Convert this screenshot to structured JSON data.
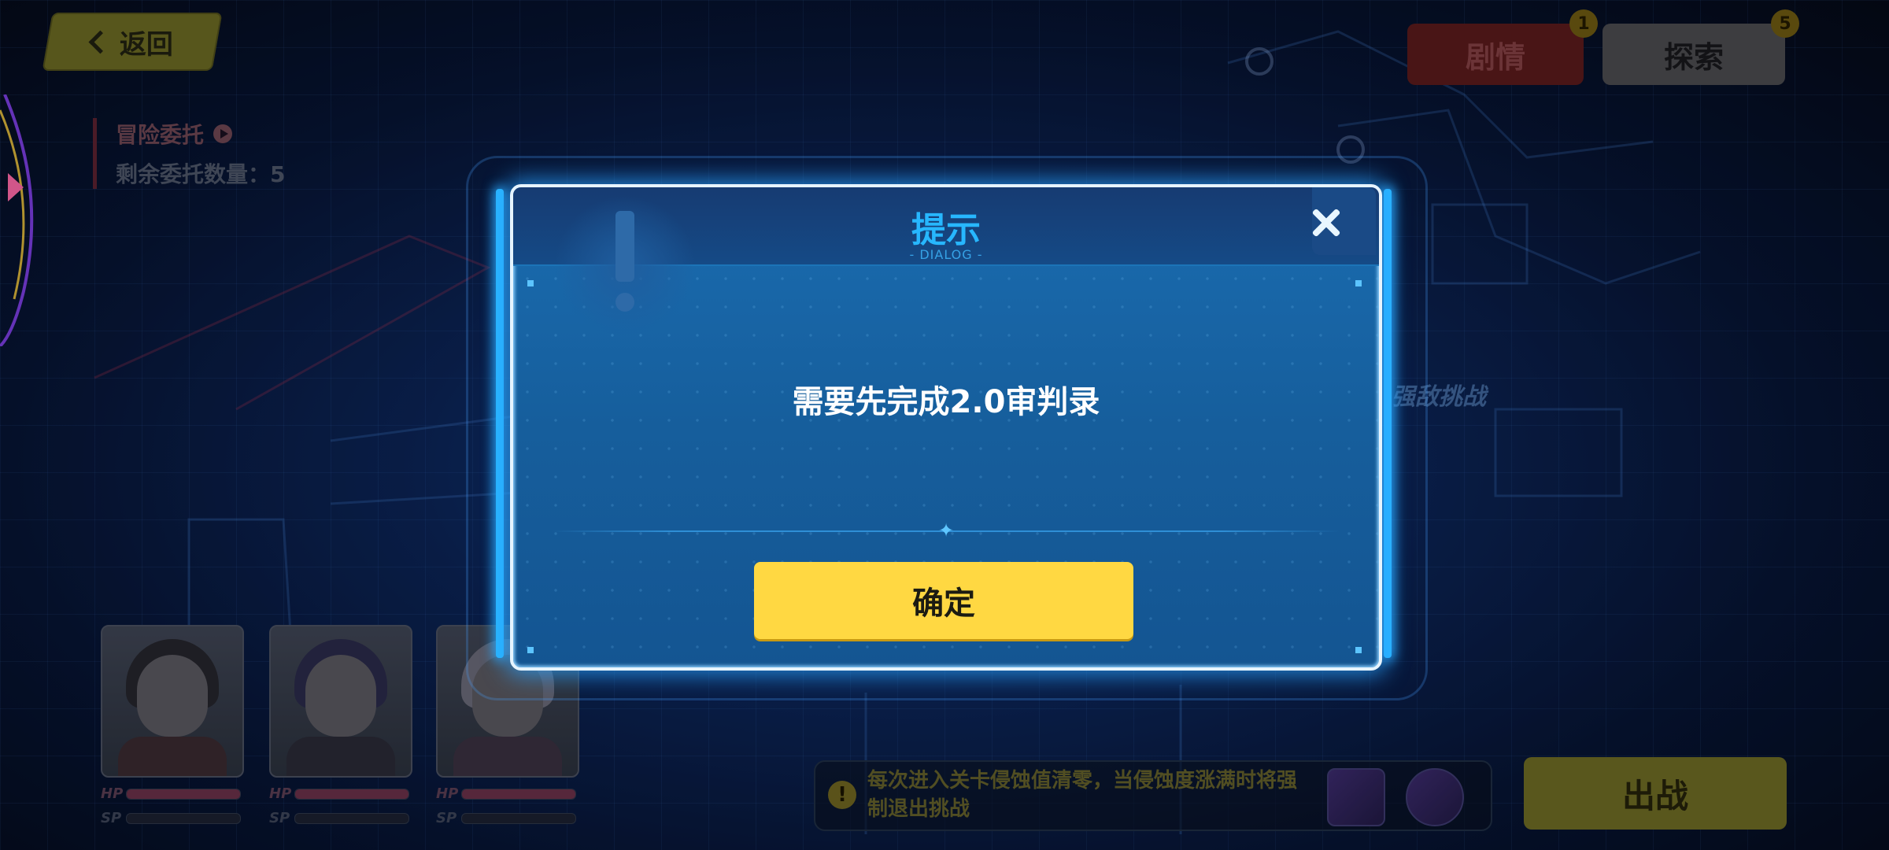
{
  "header": {
    "back_label": "返回",
    "mission_title": "冒险委托",
    "mission_remaining": "剩余委托数量：5",
    "tabs": [
      {
        "label": "剧情",
        "badge": "1"
      },
      {
        "label": "探索",
        "badge": "5"
      }
    ]
  },
  "map": {
    "challenge_label": "强敌挑战"
  },
  "party": [
    {
      "hp_label": "HP",
      "sp_label": "SP",
      "hp_fill": 1.0,
      "sp_fill": 0.0
    },
    {
      "hp_label": "HP",
      "sp_label": "SP",
      "hp_fill": 1.0,
      "sp_fill": 0.0
    },
    {
      "hp_label": "HP",
      "sp_label": "SP",
      "hp_fill": 1.0,
      "sp_fill": 0.0
    }
  ],
  "footer": {
    "tip_text": "每次进入关卡侵蚀值清零，当侵蚀度涨满时将强制退出挑战",
    "fight_label": "出战"
  },
  "dialog": {
    "title": "提示",
    "subtitle": "- DIALOG -",
    "message": "需要先完成2.0审判录",
    "confirm_label": "确定"
  },
  "colors": {
    "accent": "#27b7ff",
    "confirm": "#ffd842"
  }
}
